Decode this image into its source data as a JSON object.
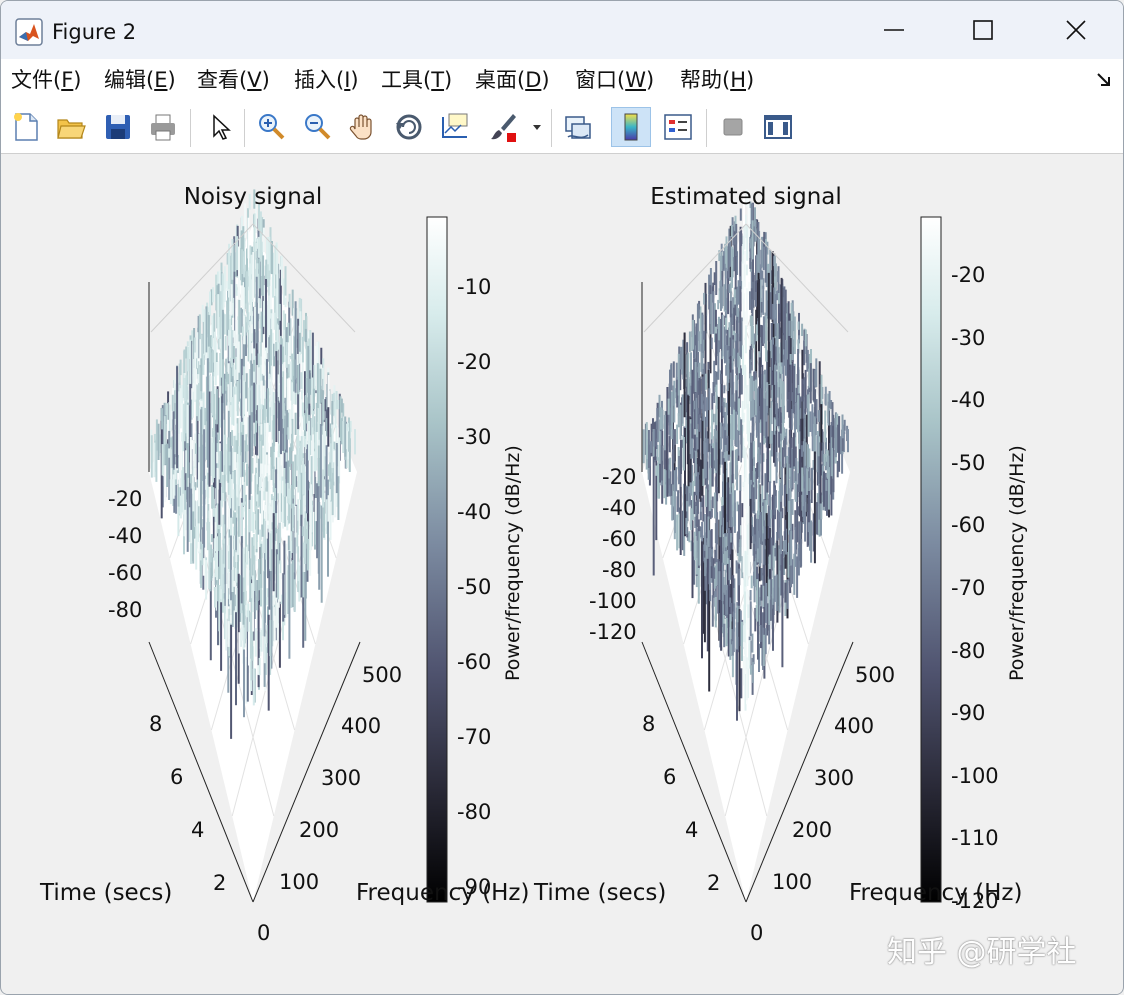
{
  "window": {
    "title": "Figure 2"
  },
  "menu": [
    {
      "pre": "文件(",
      "key": "F",
      "post": ")"
    },
    {
      "pre": "编辑(",
      "key": "E",
      "post": ")"
    },
    {
      "pre": "查看(",
      "key": "V",
      "post": ")"
    },
    {
      "pre": "插入(",
      "key": "I",
      "post": ")"
    },
    {
      "pre": "工具(",
      "key": "T",
      "post": ")"
    },
    {
      "pre": "桌面(",
      "key": "D",
      "post": ")"
    },
    {
      "pre": "窗口(",
      "key": "W",
      "post": ")"
    },
    {
      "pre": "帮助(",
      "key": "H",
      "post": ")"
    }
  ],
  "toolbar": [
    "new-figure-icon",
    "open-file-icon",
    "save-icon",
    "print-icon",
    "edit-plot-pointer-icon",
    "zoom-in-icon",
    "zoom-out-icon",
    "pan-hand-icon",
    "rotate-3d-icon",
    "data-cursor-icon",
    "brush-icon",
    "link-plot-icon",
    "colorbar-icon",
    "legend-icon",
    "hide-plot-tools-icon",
    "show-plot-tools-icon"
  ],
  "plots": {
    "left": {
      "title": "Noisy signal",
      "z_ticks": [
        "-20",
        "-40",
        "-60",
        "-80"
      ],
      "time_ticks": [
        "2",
        "4",
        "6",
        "8"
      ],
      "freq_ticks": [
        "0",
        "100",
        "200",
        "300",
        "400",
        "500"
      ],
      "time_label": "Time (secs)",
      "freq_label": "Frequency (Hz)",
      "colorbar_ticks": [
        "-10",
        "-20",
        "-30",
        "-40",
        "-50",
        "-60",
        "-70",
        "-80",
        "-90"
      ],
      "colorbar_label": "Power/frequency (dB/Hz)"
    },
    "right": {
      "title": "Estimated signal",
      "z_ticks": [
        "-20",
        "-40",
        "-60",
        "-80",
        "-100",
        "-120"
      ],
      "time_ticks": [
        "2",
        "4",
        "6",
        "8"
      ],
      "freq_ticks": [
        "0",
        "100",
        "200",
        "300",
        "400",
        "500"
      ],
      "time_label": "Time (secs)",
      "freq_label": "Frequency (Hz)",
      "colorbar_ticks": [
        "-20",
        "-30",
        "-40",
        "-50",
        "-60",
        "-70",
        "-80",
        "-90",
        "-100",
        "-110",
        "-120"
      ],
      "colorbar_label": "Power/frequency (dB/Hz)"
    }
  },
  "colors": {
    "colormap": [
      "#000000",
      "#2a2a38",
      "#505470",
      "#7b8aa0",
      "#a9c4c8",
      "#d8ecec",
      "#ffffff"
    ]
  },
  "watermark": "知乎 @研学社"
}
